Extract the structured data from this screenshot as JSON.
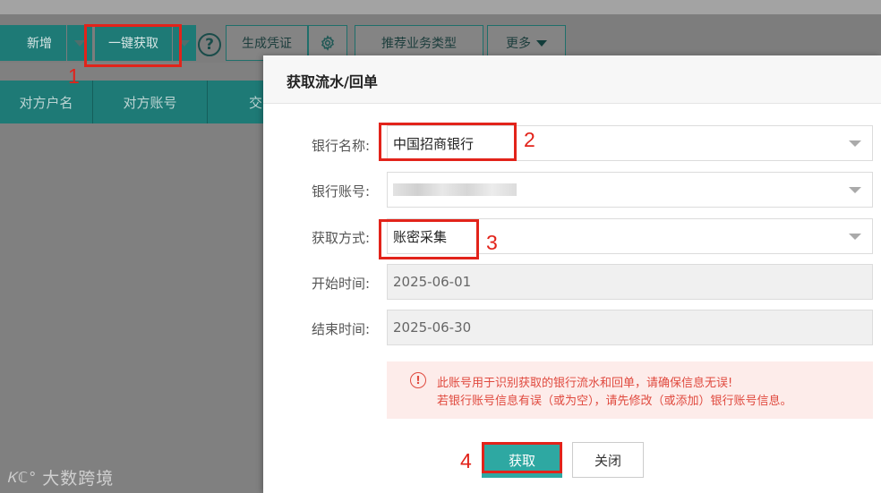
{
  "toolbar": {
    "new_label": "新增",
    "one_click_fetch_label": "一键获取",
    "help_symbol": "?",
    "generate_voucher_label": "生成凭证",
    "recommend_business_type_label": "推荐业务类型",
    "more_label": "更多"
  },
  "table": {
    "headers": [
      "对方户名",
      "对方账号",
      "交"
    ]
  },
  "watermark": {
    "logo": "Ꮶℂ°",
    "text": "大数跨境"
  },
  "annotations": {
    "step1": "1",
    "step2": "2",
    "step3": "3",
    "step4": "4"
  },
  "dialog": {
    "title": "获取流水/回单",
    "fields": {
      "bank_name": {
        "label": "银行名称:",
        "value": "中国招商银行"
      },
      "bank_account": {
        "label": "银行账号:",
        "value": ""
      },
      "fetch_method": {
        "label": "获取方式:",
        "value": "账密采集"
      },
      "start_time": {
        "label": "开始时间:",
        "value": "2025-06-01"
      },
      "end_time": {
        "label": "结束时间:",
        "value": "2025-06-30"
      }
    },
    "notice": {
      "icon": "!",
      "line1": "此账号用于识别获取的银行流水和回单，请确保信息无误!",
      "line2": "若银行账号信息有误（或为空），请先修改（或添加）银行账号信息。"
    },
    "fetch_button": "获取",
    "close_button": "关闭"
  },
  "colors": {
    "accent": "#2ea8a2",
    "annotation_red": "#e2231a",
    "notice_text": "#e04a3f"
  }
}
